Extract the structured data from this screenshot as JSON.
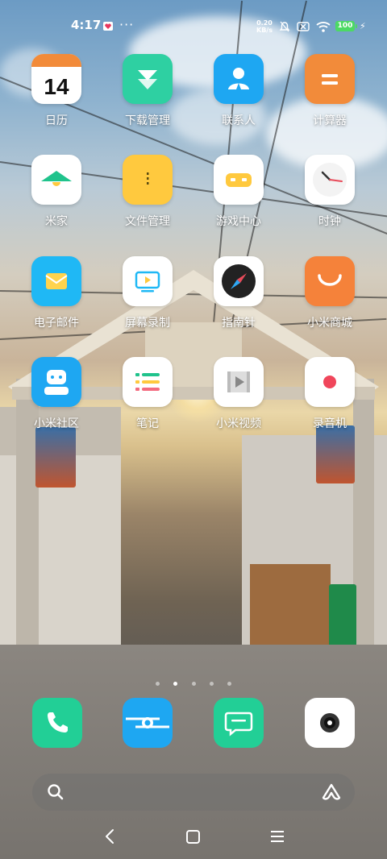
{
  "status_bar": {
    "time": "4:17",
    "more_indicator": "···",
    "net_speed_value": "0.20",
    "net_speed_unit": "KB/s",
    "battery_level": "100",
    "icons": [
      "heart-notification-icon",
      "alarm-icon",
      "sim-off-icon",
      "wifi-icon",
      "battery-icon",
      "charging-icon"
    ]
  },
  "apps": [
    {
      "label": "日历",
      "icon": "calendar-icon",
      "detail": "14",
      "color": "#ffffff"
    },
    {
      "label": "下载管理",
      "icon": "download-icon",
      "color": "#2ed0a2"
    },
    {
      "label": "联系人",
      "icon": "contacts-icon",
      "color": "#1ea7f2"
    },
    {
      "label": "计算器",
      "icon": "calculator-icon",
      "color": "#f28b3a"
    },
    {
      "label": "米家",
      "icon": "mijia-icon",
      "color": "#ffffff"
    },
    {
      "label": "文件管理",
      "icon": "file-manager-icon",
      "color": "#ffc93e"
    },
    {
      "label": "游戏中心",
      "icon": "game-center-icon",
      "color": "#ffffff"
    },
    {
      "label": "时钟",
      "icon": "clock-icon",
      "color": "#ffffff"
    },
    {
      "label": "电子邮件",
      "icon": "email-icon",
      "color": "#1fb8f5"
    },
    {
      "label": "屏幕录制",
      "icon": "screen-recorder-icon",
      "color": "#ffffff"
    },
    {
      "label": "指南针",
      "icon": "compass-icon",
      "color": "#ffffff"
    },
    {
      "label": "小米商城",
      "icon": "mi-store-icon",
      "color": "#f5823a"
    },
    {
      "label": "小米社区",
      "icon": "mi-community-icon",
      "color": "#1ea7f2"
    },
    {
      "label": "笔记",
      "icon": "notes-icon",
      "color": "#ffffff"
    },
    {
      "label": "小米视频",
      "icon": "mi-video-icon",
      "color": "#ffffff"
    },
    {
      "label": "录音机",
      "icon": "recorder-icon",
      "color": "#ffffff"
    }
  ],
  "pager": {
    "pages": 5,
    "active": 1
  },
  "dock": [
    "phone-icon",
    "browser-icon",
    "messages-icon",
    "camera-icon"
  ],
  "search_bar": {
    "left_icon": "search-icon",
    "right_icon": "assistant-icon"
  },
  "nav_bar": [
    "back-icon",
    "home-icon",
    "recents-icon"
  ]
}
